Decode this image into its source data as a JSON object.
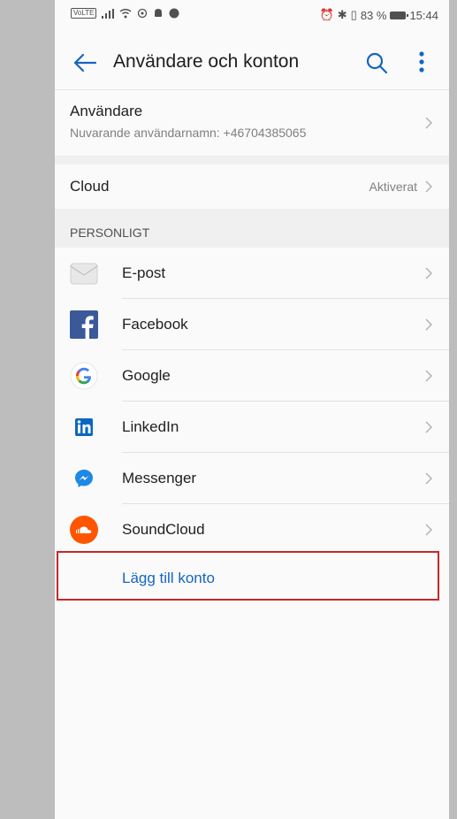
{
  "status_bar": {
    "volte": "VoLTE",
    "battery_percent": "83 %",
    "time": "15:44"
  },
  "header": {
    "title": "Användare och konton",
    "back_icon": "back-arrow-icon",
    "search_icon": "search-icon",
    "menu_icon": "more-vert-icon"
  },
  "user": {
    "label": "Användare",
    "subtitle": "Nuvarande användarnamn: +46704385065"
  },
  "cloud": {
    "label": "Cloud",
    "value": "Aktiverat"
  },
  "section": {
    "title": "PERSONLIGT"
  },
  "accounts": [
    {
      "name": "E-post",
      "icon": "email-icon"
    },
    {
      "name": "Facebook",
      "icon": "facebook-icon"
    },
    {
      "name": "Google",
      "icon": "google-icon"
    },
    {
      "name": "LinkedIn",
      "icon": "linkedin-icon"
    },
    {
      "name": "Messenger",
      "icon": "messenger-icon"
    },
    {
      "name": "SoundCloud",
      "icon": "soundcloud-icon"
    }
  ],
  "add_account_label": "Lägg till konto",
  "colors": {
    "accent": "#1565c0",
    "highlight": "#c62828",
    "facebook": "#3b5998",
    "linkedin": "#0a66c2",
    "messenger": "#1e88e5",
    "soundcloud": "#ff5500"
  }
}
